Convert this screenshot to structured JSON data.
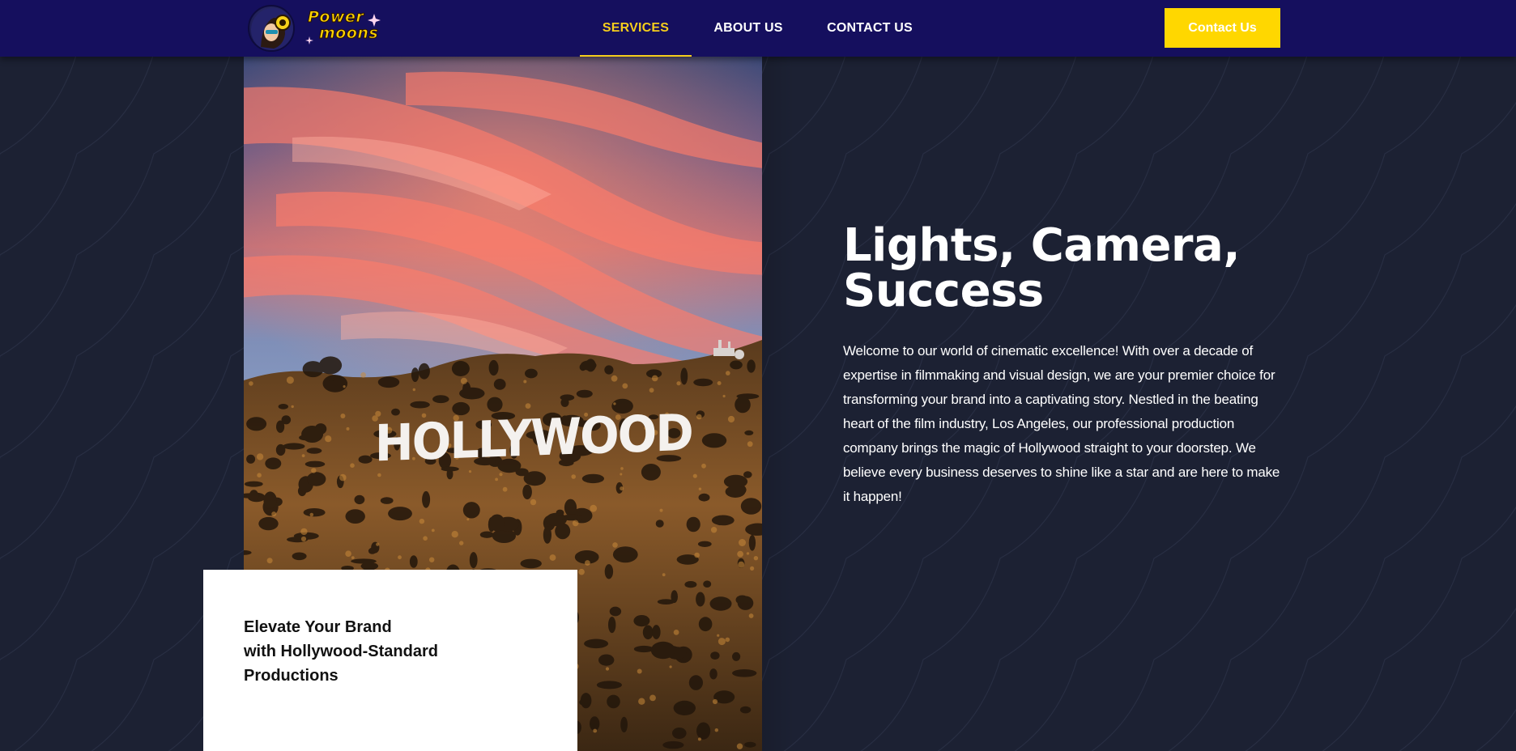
{
  "brand": {
    "logo_line1": "Power",
    "logo_line2": "moons",
    "logo_icon": "astronaut-mascot-icon",
    "accent_color": "#ffd700",
    "nav_bg": "#150f5e",
    "page_bg": "#1c2133"
  },
  "nav": {
    "items": [
      {
        "label": "SERVICES",
        "active": true
      },
      {
        "label": "ABOUT US",
        "active": false
      },
      {
        "label": "CONTACT US",
        "active": false
      }
    ],
    "cta_label": "Contact Us"
  },
  "hero": {
    "image_sign_text": "HOLLYWOOD",
    "card_lines": [
      "Elevate Your Brand",
      "with Hollywood-Standard",
      "Productions"
    ],
    "heading_lines": [
      "Lights, Camera,",
      "Success"
    ],
    "body": "Welcome to our world of cinematic excellence! With over a decade of expertise in filmmaking and visual design, we are your premier choice for transforming your brand into a captivating story. Nestled in the beating heart of the film industry, Los Angeles, our professional production company brings the magic of Hollywood straight to your doorstep. We believe every business deserves to shine like a star and are here to make it happen!"
  }
}
